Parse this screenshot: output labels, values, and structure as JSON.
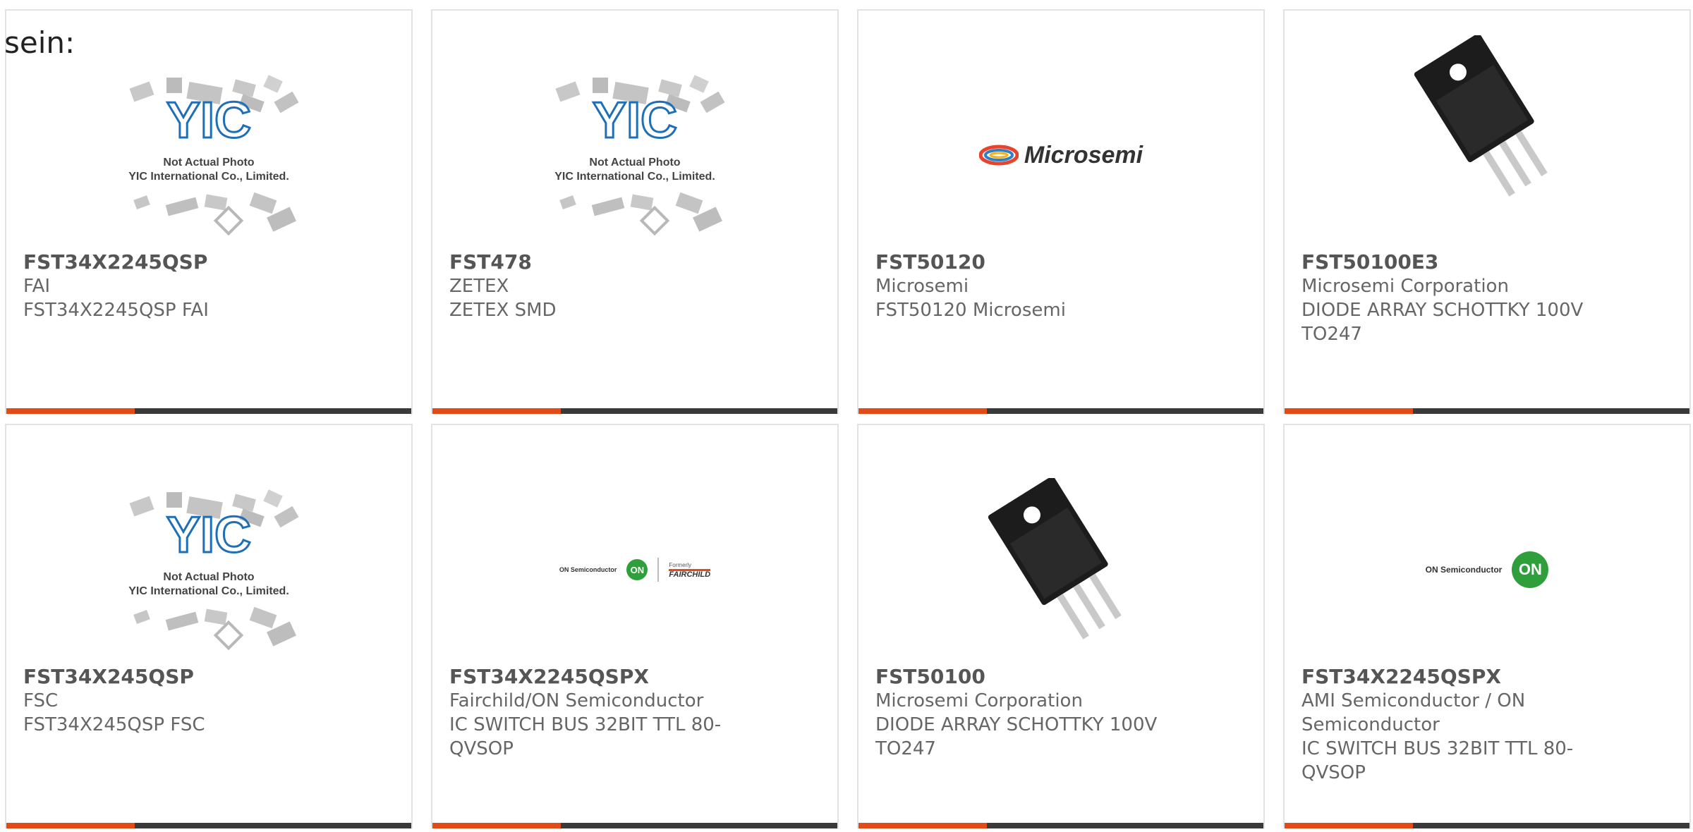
{
  "intro_text": "sein:",
  "cards": [
    {
      "part": "FST34X2245QSP",
      "lines": [
        "FAI",
        "FST34X2245QSP FAI"
      ],
      "image": "yic-placeholder"
    },
    {
      "part": "FST478",
      "lines": [
        "ZETEX",
        "ZETEX SMD"
      ],
      "image": "yic-placeholder"
    },
    {
      "part": "FST50120",
      "lines": [
        "Microsemi",
        "FST50120 Microsemi"
      ],
      "image": "microsemi-logo"
    },
    {
      "part": "FST50100E3",
      "lines": [
        "Microsemi Corporation",
        "DIODE ARRAY SCHOTTKY 100V",
        "TO247"
      ],
      "image": "to247-photo"
    },
    {
      "part": "FST34X245QSP",
      "lines": [
        "FSC",
        "FST34X245QSP FSC"
      ],
      "image": "yic-placeholder"
    },
    {
      "part": "FST34X2245QSPX",
      "lines": [
        "Fairchild/ON Semiconductor",
        "IC SWITCH BUS 32BIT TTL 80-",
        "QVSOP"
      ],
      "image": "on-fairchild-logo"
    },
    {
      "part": "FST50100",
      "lines": [
        "Microsemi Corporation",
        "DIODE ARRAY SCHOTTKY 100V",
        "TO247"
      ],
      "image": "to247-photo"
    },
    {
      "part": "FST34X2245QSPX",
      "lines": [
        "AMI Semiconductor / ON",
        "Semiconductor",
        "IC SWITCH BUS 32BIT TTL 80-",
        "QVSOP"
      ],
      "image": "on-semiconductor-logo"
    }
  ],
  "placeholder": {
    "line1": "Not Actual Photo",
    "line2": "YIC International Co., Limited."
  },
  "logos": {
    "microsemi": "Microsemi",
    "on_semi": "ON Semiconductor",
    "on_badge": "ON",
    "formerly": "Formerly",
    "fairchild": "FAIRCHILD"
  },
  "colors": {
    "accent": "#e24a17",
    "bar": "#3a3a3a",
    "border": "#e3e3e3",
    "text": "#666666",
    "yic_blue": "#1e6fb8",
    "on_green": "#2e9f3a"
  }
}
